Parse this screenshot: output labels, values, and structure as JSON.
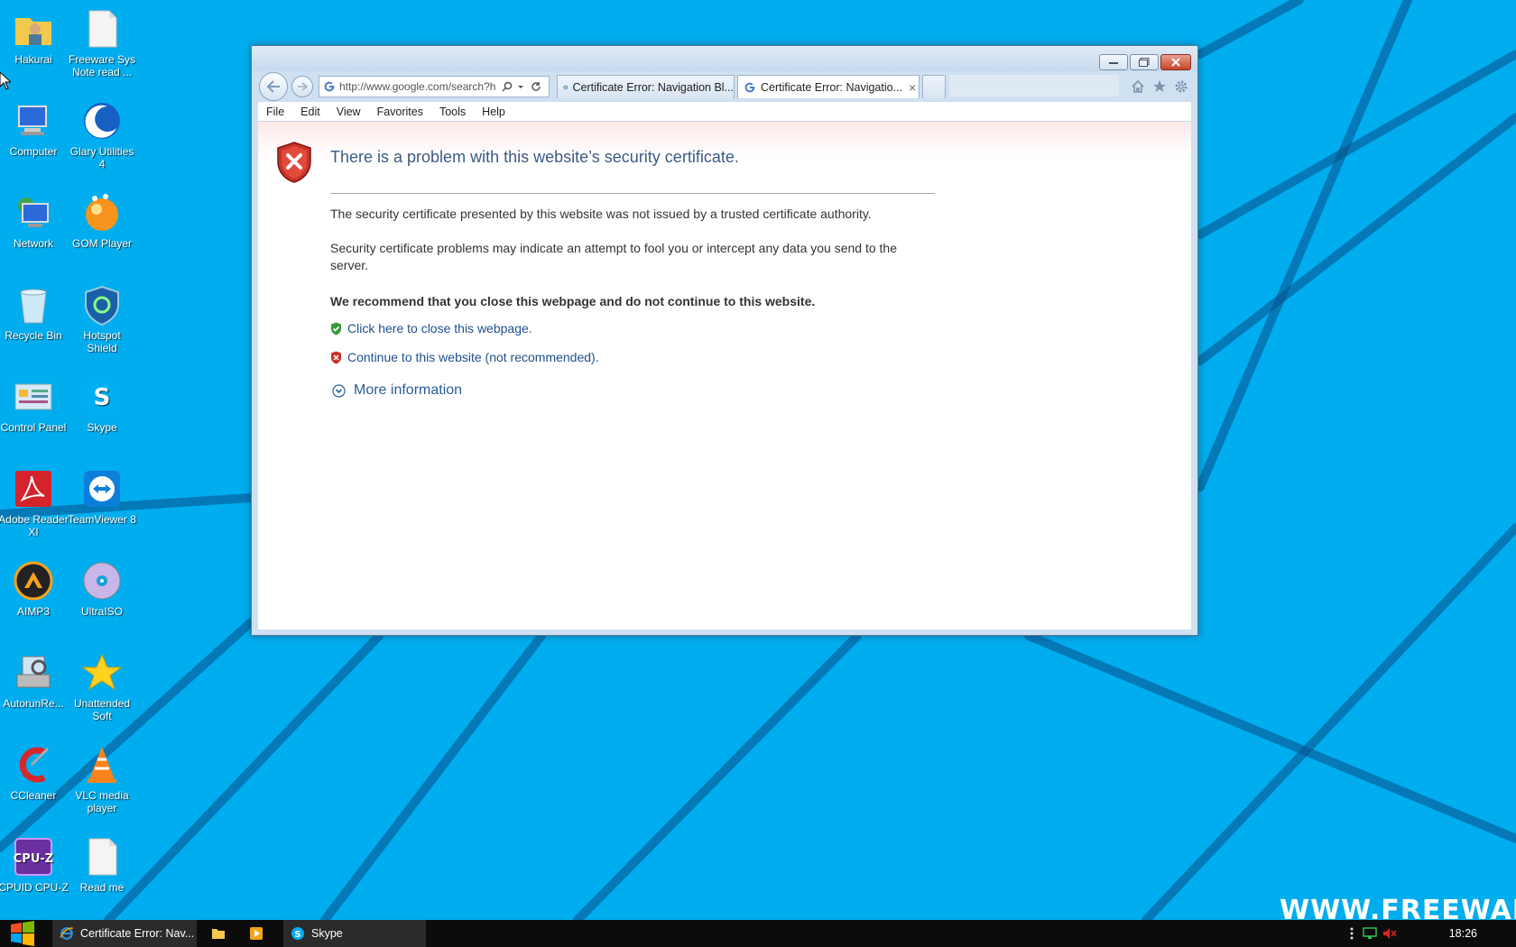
{
  "desktop": {
    "icons": [
      {
        "label": "Hakurai"
      },
      {
        "label": "Freeware Sys Note read ..."
      },
      {
        "label": "Computer"
      },
      {
        "label": "Glary Utilities 4"
      },
      {
        "label": "Network"
      },
      {
        "label": "GOM Player"
      },
      {
        "label": "Recycle Bin"
      },
      {
        "label": "Hotspot Shield"
      },
      {
        "label": "Control Panel"
      },
      {
        "label": "Skype"
      },
      {
        "label": "Adobe Reader XI"
      },
      {
        "label": "TeamViewer 8"
      },
      {
        "label": "AIMP3"
      },
      {
        "label": "UltraISO"
      },
      {
        "label": "AutorunRe..."
      },
      {
        "label": "Unattended Soft"
      },
      {
        "label": "CCleaner"
      },
      {
        "label": "VLC media player"
      },
      {
        "label": "CPUID CPU-Z"
      },
      {
        "label": "Read me"
      }
    ],
    "watermark": "WWW.FREEWARESY"
  },
  "browser": {
    "address": {
      "url": "http://www.google.com/search?h"
    },
    "tabs": [
      {
        "label": "Certificate Error: Navigation Bl..."
      },
      {
        "label": "Certificate Error: Navigatio..."
      }
    ],
    "tab_close_glyph": "×",
    "menu": [
      "File",
      "Edit",
      "View",
      "Favorites",
      "Tools",
      "Help"
    ],
    "page": {
      "title": "There is a problem with this website’s security certificate.",
      "paragraph1": "The security certificate presented by this website was not issued by a trusted certificate authority.",
      "paragraph2": "Security certificate problems may indicate an attempt to fool you or intercept any data you send to the server.",
      "recommendation": "We recommend that you close this webpage and do not continue to this website.",
      "close_link": "Click here to close this webpage.",
      "continue_link": "Continue to this website (not recommended).",
      "more_info": "More information"
    }
  },
  "taskbar": {
    "items": [
      {
        "label": "Certificate Error: Nav..."
      },
      {
        "label": "Skype"
      }
    ],
    "clock": "18:26"
  },
  "colors": {
    "desktop": "#00adee",
    "title_text": "#3b5a86",
    "link": "#1f4f8c",
    "error_red": "#c8332a",
    "safe_green": "#3a9b3a"
  }
}
